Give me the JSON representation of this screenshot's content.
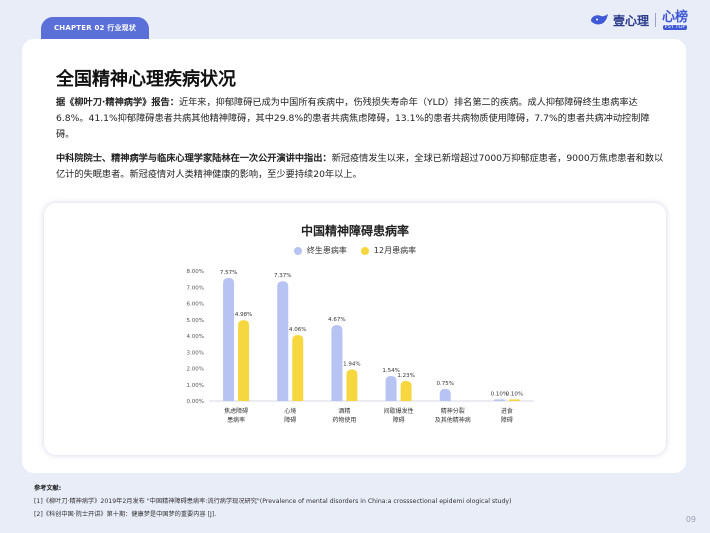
{
  "header": {
    "tab_label": "CHAPTER 02  行业现状",
    "brand_name": "壹心理",
    "brand_sub_big": "心榜",
    "brand_sub_small": "PSY TOP"
  },
  "main": {
    "title": "全国精神心理疾病状况",
    "para1_lead": "据《柳叶刀·精神病学》报告：",
    "para1_body": "近年来，抑郁障碍已成为中国所有疾病中，伤残损失寿命年（YLD）排名第二的疾病。成人抑郁障碍终生患病率达6.8%。41.1%抑郁障碍患者共病其他精神障碍，其中29.8%的患者共病焦虑障碍，13.1%的患者共病物质使用障碍，7.7%的患者共病冲动控制障碍。",
    "para2_lead": "中科院院士、精神病学与临床心理学家陆林在一次公开演讲中指出：",
    "para2_body": "新冠疫情发生以来，全球已新增超过7000万抑郁症患者，9000万焦虑患者和数以亿计的失眠患者。新冠疫情对人类精神健康的影响，至少要持续20年以上。"
  },
  "chart_data": {
    "type": "bar",
    "title": "中国精神障碍患病率",
    "categories": [
      "焦虑障碍\n患病率",
      "心境\n障碍",
      "酒精\n药物使用",
      "间歇爆发性\n障碍",
      "精神分裂\n及其他精神病",
      "进食\n障碍"
    ],
    "series": [
      {
        "name": "终生患病率",
        "values": [
          7.57,
          7.37,
          4.67,
          1.54,
          0.75,
          0.1
        ],
        "labels": [
          "7.57%",
          "7.37%",
          "4.67%",
          "1.54%",
          "0.75%",
          "0.10%"
        ]
      },
      {
        "name": "12月患病率",
        "values": [
          4.98,
          4.06,
          1.94,
          1.23,
          null,
          0.1
        ],
        "labels": [
          "4.98%",
          "4.06%",
          "1.94%",
          "1.23%",
          "",
          "0.10%"
        ]
      }
    ],
    "yticks": [
      "8.00%",
      "7.00%",
      "6.00%",
      "5.00%",
      "4.00%",
      "3.00%",
      "2.00%",
      "1.00%",
      "0.00%"
    ],
    "ylim": [
      0,
      8
    ],
    "colors": [
      "#b7c3f2",
      "#f7d740"
    ],
    "grid": false
  },
  "references": {
    "title": "参考文献:",
    "items": [
      "[1]《柳叶刀·精神病学》2019年2月发布 \"中国精神障碍患病率:流行病学现况研究\"(Prevalence of mental disorders in China:a crosssectional epidemi ological study)",
      "[2]《科创中国·院士开讲》第十期：健康梦是中国梦的重要内容 [J]."
    ]
  },
  "page_number": "09"
}
